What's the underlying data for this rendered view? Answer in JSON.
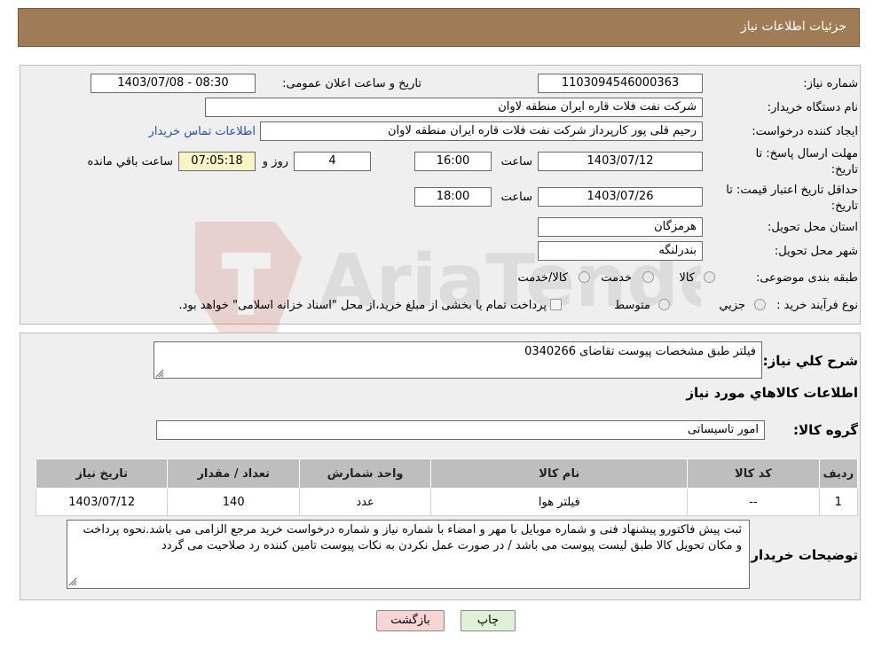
{
  "header": {
    "title": "جزئیات اطلاعات نیاز"
  },
  "fields": {
    "need_number_label": "شماره نیاز:",
    "need_number": "1103094546000363",
    "announce_label": "تاریخ و ساعت اعلان عمومی:",
    "announce_value": "1403/07/08 - 08:30",
    "buyer_org_label": "نام دستگاه خریدار:",
    "buyer_org": "شرکت نفت فلات قاره ایران منطقه لاوان",
    "creator_label": "ایجاد کننده درخواست:",
    "creator": "رحیم قلی پور کارپرداز شرکت نفت فلات قاره ایران منطقه لاوان",
    "contact_link": "اطلاعات تماس خریدار",
    "deadline_label_line1": "مهلت ارسال پاسخ: تا",
    "deadline_label_line2": "تاریخ:",
    "deadline_date": "1403/07/12",
    "time_label": "ساعت",
    "deadline_time": "16:00",
    "days_value": "4",
    "days_label": "روز و",
    "remaining_time": "07:05:18",
    "remaining_label": "ساعت باقي مانده",
    "validity_label_line1": "حداقل تاریخ اعتبار قیمت: تا",
    "validity_label_line2": "تاریخ:",
    "validity_date": "1403/07/26",
    "validity_time": "18:00",
    "province_label": "استان محل تحویل:",
    "province": "هرمزگان",
    "city_label": "شهر محل تحویل:",
    "city": "بندرلنگه",
    "category_label": "طبقه بندی موضوعی:",
    "category_options": [
      "کالا",
      "خدمت",
      "کالا/خدمت"
    ],
    "process_label": "نوع فرآیند خرید :",
    "process_options": [
      "جزيي",
      "متوسط"
    ],
    "process_note": "پرداخت تمام یا بخشی از مبلغ خرید،از محل \"اسناد خزانه اسلامی\" خواهد بود."
  },
  "summary": {
    "general_desc_label": "شرح کلي نياز:",
    "general_desc": "فیلتر طبق مشخصات پیوست تقاضای 0340266",
    "goods_info_title": "اطلاعات کالاهاي مورد نياز",
    "goods_group_label": "گروه کالا:",
    "goods_group": "امور تاسیساتی"
  },
  "table": {
    "headers": [
      "رديف",
      "کد کالا",
      "نام کالا",
      "واحد شمارش",
      "تعداد / مقدار",
      "تاريخ نياز"
    ],
    "rows": [
      [
        "1",
        "--",
        "فیلتر هوا",
        "عدد",
        "140",
        "1403/07/12"
      ]
    ]
  },
  "buyer_notes": {
    "label": "توضیحات خریدار:",
    "text": "ثبت پیش فاکتورو پیشنهاد فنی و شماره موبایل با مهر و امضاء با شماره نیاز و شماره درخواست خرید مرجع الزامی می باشد.نحوه پرداخت و مکان تحویل کالا طبق لیست پیوست می باشد / در صورت عمل نکردن به نکات پیوست تامین کننده رد صلاحیت می گردد"
  },
  "buttons": {
    "print": "چاپ",
    "back": "بازگشت"
  },
  "watermark_text": "AriaTender.neT",
  "colors": {
    "header": "#a07c56",
    "link": "#1d4fbf",
    "back_button": "#f7d5d5",
    "print_button": "#dff2d8"
  }
}
